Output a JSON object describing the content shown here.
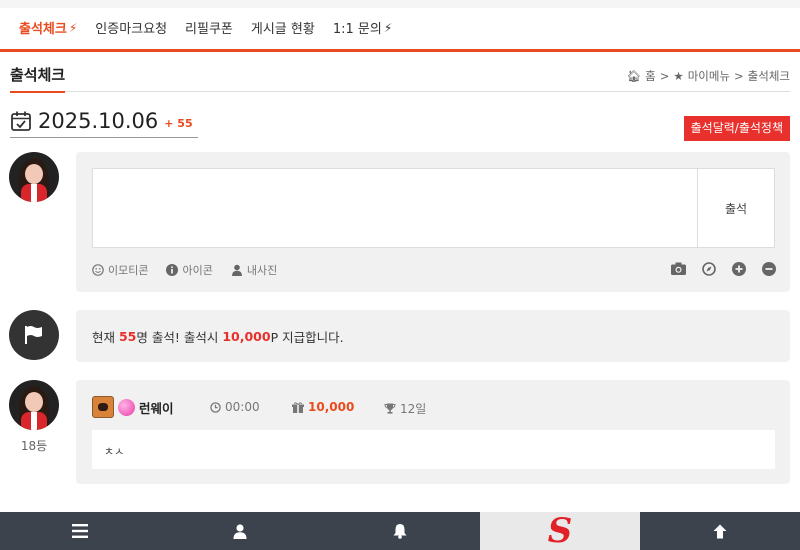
{
  "tabs": [
    {
      "label": "출석체크",
      "bolt": true,
      "active": true
    },
    {
      "label": "인증마크요청",
      "bolt": false,
      "active": false
    },
    {
      "label": "리필쿠폰",
      "bolt": false,
      "active": false
    },
    {
      "label": "게시글 현황",
      "bolt": false,
      "active": false
    },
    {
      "label": "1:1 문의",
      "bolt": true,
      "active": false
    }
  ],
  "page": {
    "title": "출석체크",
    "breadcrumb": [
      "홈",
      "마이메뉴",
      "출석체크"
    ]
  },
  "date": {
    "value": "2025.10.06",
    "count": "+ 55"
  },
  "policy_button": "출석달력/출석정책",
  "write": {
    "submit_label": "출석",
    "tools": [
      "이모티콘",
      "아이콘",
      "내사진"
    ]
  },
  "notice": {
    "prefix": "현재 ",
    "count": "55",
    "mid": "명 출석! 출석시 ",
    "points": "10,000",
    "suffix": "P 지급합니다."
  },
  "entry": {
    "rank": "18등",
    "nickname": "런웨이",
    "time": "00:00",
    "points": "10,000",
    "days": "12일",
    "message": "ㅊㅅ"
  },
  "colors": {
    "accent": "#e84b1e",
    "danger": "#e8302c",
    "nav_bg": "#3c434c"
  }
}
